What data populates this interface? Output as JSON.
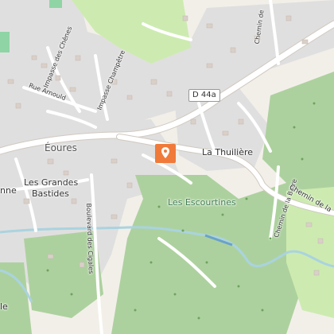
{
  "map": {
    "places": {
      "eoures": "Éoures",
      "la_thuiliere": "La Thuilière",
      "les_grandes": "Les Grandes",
      "bastides": "Bastides",
      "les_escourtines": "Les Escourtines"
    },
    "roads": {
      "d44a": "D 44a",
      "rue_arnould": "Rue Arnould",
      "impasse_chenes": "Impasse des Chênes",
      "impasse_champetre": "Impasse Champêtre",
      "boulevard_cigales": "Boulevard des Cigales",
      "chemin_barre": "Chemin de la Barre",
      "chemin_la_right": "Chemin de la",
      "chemin_de_top": "Chemin de",
      "nne_left": "nne",
      "le_left": "le"
    },
    "marker_icon": "map-pin-icon",
    "colors": {
      "land": "#f2efe9",
      "forest": "#add19e",
      "grass": "#cdebb0",
      "residential": "#e0dfdf",
      "road": "#ffffff",
      "road_edge": "#cfc9c0",
      "water": "#aad3df",
      "marker": "#f07a3a"
    }
  }
}
